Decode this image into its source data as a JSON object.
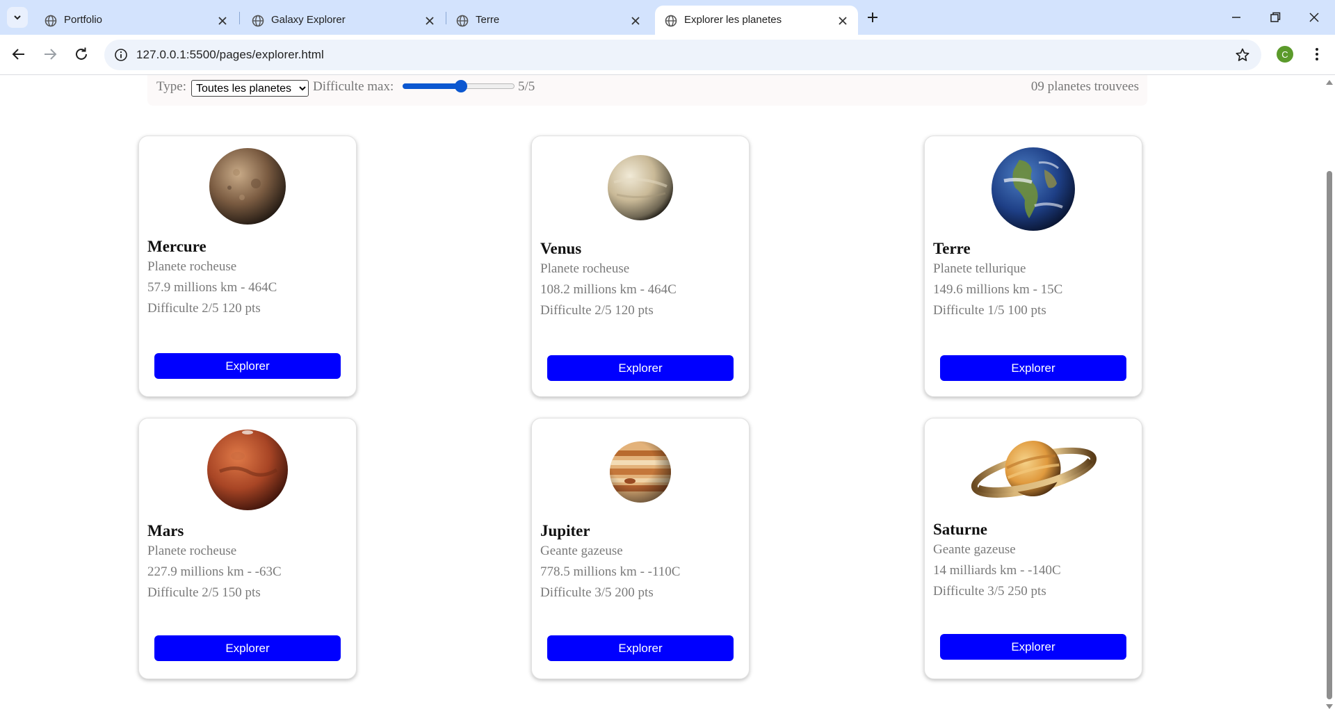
{
  "browser": {
    "tabs": [
      {
        "title": "Portfolio",
        "active": false
      },
      {
        "title": "Galaxy Explorer",
        "active": false
      },
      {
        "title": "Terre",
        "active": false
      },
      {
        "title": "Explorer les planetes",
        "active": true
      }
    ],
    "url": "127.0.0.1:5500/pages/explorer.html",
    "profile_initial": "C"
  },
  "filters": {
    "type_label": "Type:",
    "type_selected": "Toutes les planetes",
    "difficulty_label": "Difficulte max:",
    "difficulty_value": 5,
    "difficulty_max": 5,
    "difficulty_display": "5/5",
    "count_text": "09 planetes trouvees"
  },
  "planets": [
    {
      "name": "Mercure",
      "type": "Planete rocheuse",
      "stats": "57.9 millions km - 464C",
      "difficulty": "Difficulte 2/5 120 pts",
      "button": "Explorer"
    },
    {
      "name": "Venus",
      "type": "Planete rocheuse",
      "stats": "108.2 millions km - 464C",
      "difficulty": "Difficulte 2/5 120 pts",
      "button": "Explorer"
    },
    {
      "name": "Terre",
      "type": "Planete tellurique",
      "stats": "149.6 millions km - 15C",
      "difficulty": "Difficulte 1/5 100 pts",
      "button": "Explorer"
    },
    {
      "name": "Mars",
      "type": "Planete rocheuse",
      "stats": "227.9 millions km - -63C",
      "difficulty": "Difficulte 2/5 150 pts",
      "button": "Explorer"
    },
    {
      "name": "Jupiter",
      "type": "Geante gazeuse",
      "stats": "778.5 millions km - -110C",
      "difficulty": "Difficulte 3/5 200 pts",
      "button": "Explorer"
    },
    {
      "name": "Saturne",
      "type": "Geante gazeuse",
      "stats": "14 milliards km - -140C",
      "difficulty": "Difficulte 3/5 250 pts",
      "button": "Explorer"
    }
  ],
  "colors": {
    "button": "#0000ff",
    "accent": "#0b57d0",
    "tabstrip": "#d3e3fd"
  }
}
